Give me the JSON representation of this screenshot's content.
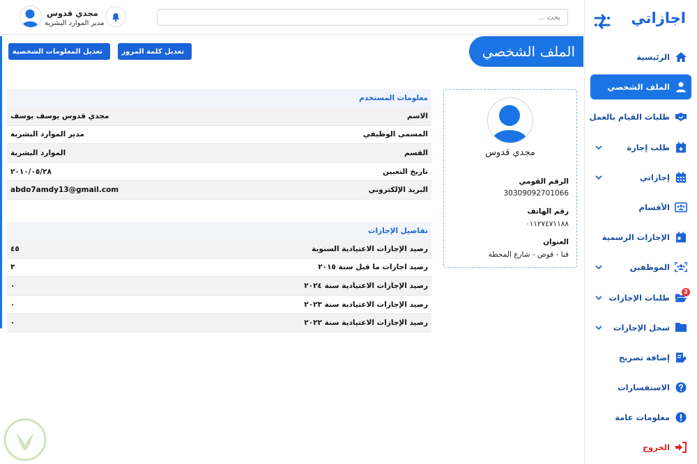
{
  "app": {
    "brand": "اجازاتي"
  },
  "topbar": {
    "search_placeholder": "بحث ...",
    "user_name": "مجدي قدوس",
    "user_role": "مدير الموارد البشرية"
  },
  "sidebar": {
    "items": [
      {
        "label": "الرئيسية",
        "icon": "home-icon"
      },
      {
        "label": "الملف الشخصي",
        "icon": "user-icon",
        "active": true
      },
      {
        "label": "طلبات القيام بالعمل",
        "icon": "handshake-icon"
      },
      {
        "label": "طلب إجازة",
        "icon": "calendar-plus-icon",
        "dropdown": true
      },
      {
        "label": "إجازاتي",
        "icon": "calendar-icon",
        "dropdown": true
      },
      {
        "label": "الأقسام",
        "icon": "departments-icon"
      },
      {
        "label": "الإجازات الرسمية",
        "icon": "calendar-day-icon"
      },
      {
        "label": "الموظفين",
        "icon": "users-icon",
        "dropdown": true
      },
      {
        "label": "طلبات الإجازات",
        "icon": "folder-open-icon",
        "dropdown": true,
        "badge": "2"
      },
      {
        "label": "سجل الإجازات",
        "icon": "folder-icon",
        "dropdown": true
      },
      {
        "label": "إضافة تصريح",
        "icon": "permit-icon"
      },
      {
        "label": "الاستفسارات",
        "icon": "question-icon"
      },
      {
        "label": "معلومات عامة",
        "icon": "info-icon"
      },
      {
        "label": "الخروج",
        "icon": "logout-icon",
        "logout": true
      }
    ]
  },
  "page": {
    "title": "الملف الشخصي",
    "btn_change_password": "تعديل كلمة المرور",
    "btn_edit_info": "تعديل المعلومات الشخصية"
  },
  "profile_card": {
    "name": "مجدي قدوس",
    "national_id_label": "الرقم القومي",
    "national_id": "30309092701066",
    "phone_label": "رقم الهاتف",
    "phone": "٠١١٢٧٤٧١١٨٨",
    "address_label": "العنوان",
    "address": "قنا - قوص - شارع المحطة"
  },
  "user_info": {
    "title": "معلومات المستخدم",
    "rows": [
      {
        "label": "الاسم",
        "value": "مجدي قدوس يوسف يوسف"
      },
      {
        "label": "المسمى الوظيفي",
        "value": "مدير الموارد البشرية"
      },
      {
        "label": "القسم",
        "value": "الموارد البشرية"
      },
      {
        "label": "تاريخ التعيين",
        "value": "٢٠١٠/٠٥/٢٨"
      },
      {
        "label": "البريد الإلكتروني",
        "value": "abdo7amdy13@gmail.com"
      }
    ]
  },
  "leave_details": {
    "title": "تفاصيل الإجازات",
    "rows": [
      {
        "label": "رصيد الإجازات الاعتيادية السنوية",
        "value": "٤٥"
      },
      {
        "label": "رصيد اجازات ما قبل سنة ٢٠١٥",
        "value": "٣"
      },
      {
        "label": "رصيد الإجازات الاعتيادية سنة ٢٠٢٤",
        "value": "٠"
      },
      {
        "label": "رصيد الإجازات الاعتيادية سنة ٢٠٢٣",
        "value": "٠"
      },
      {
        "label": "رصيد الإجازات الاعتيادية سنة ٢٠٢٢",
        "value": "٠"
      }
    ]
  },
  "colors": {
    "accent": "#1b74e4",
    "brand": "#1b63d8",
    "logout": "#e02424"
  }
}
